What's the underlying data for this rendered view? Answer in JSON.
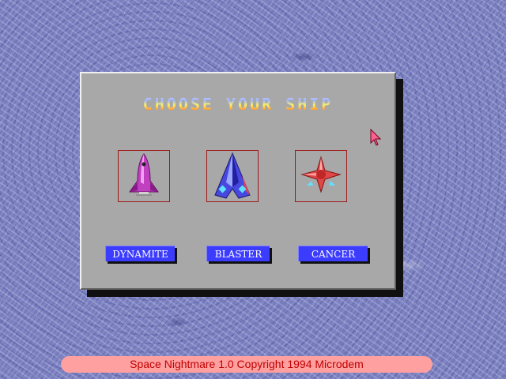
{
  "dialog": {
    "title": "CHOOSE YOUR SHIP",
    "ships": [
      {
        "name": "DYNAMITE",
        "icon": "rocket-ship-icon",
        "color": "#c040c0"
      },
      {
        "name": "BLASTER",
        "icon": "delta-wing-ship-icon",
        "color": "#4848e0"
      },
      {
        "name": "CANCER",
        "icon": "star-ship-icon",
        "color": "#e04848"
      }
    ]
  },
  "footer": {
    "text": "Space Nightmare 1.0 Copyright 1994  Microdem"
  },
  "colors": {
    "background": "#7e84c4",
    "dialog": "#a8a8a8",
    "button": "#3c3cff",
    "ship_frame": "#a01818",
    "footer_bg": "#ffa0a0",
    "footer_text": "#c00000"
  }
}
